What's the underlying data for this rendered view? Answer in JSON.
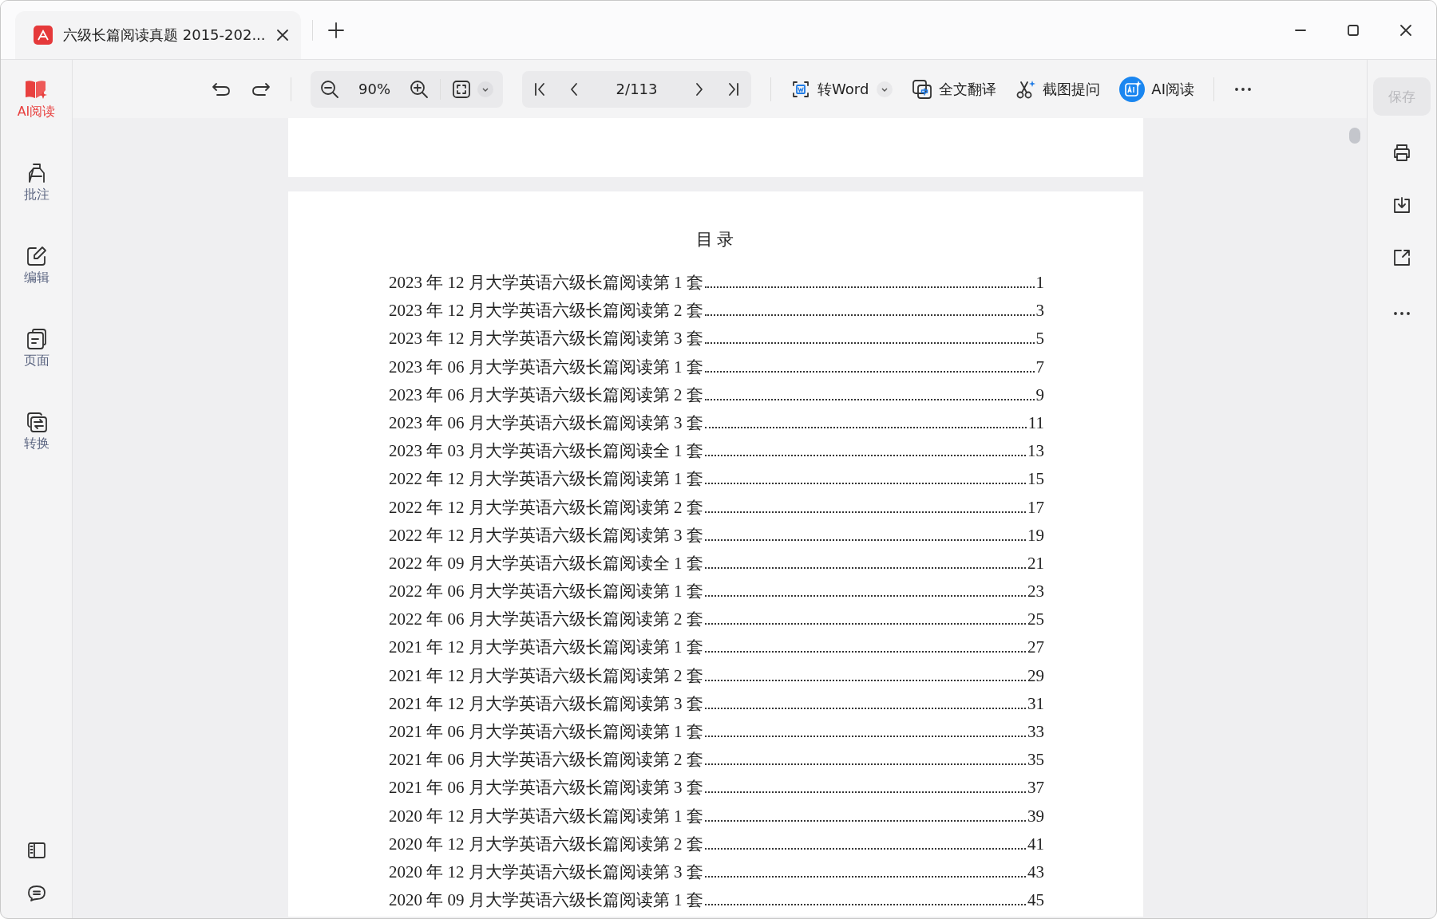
{
  "tab": {
    "title": "六级长篇阅读真题 2015-202..."
  },
  "sidebar": {
    "items": [
      {
        "label": "AI阅读",
        "kind": "ai",
        "selected": true
      },
      {
        "label": "批注",
        "kind": "annotate",
        "selected": false
      },
      {
        "label": "编辑",
        "kind": "edit",
        "selected": false
      },
      {
        "label": "页面",
        "kind": "pages",
        "selected": false
      },
      {
        "label": "转换",
        "kind": "convert",
        "selected": false
      }
    ]
  },
  "toolbar": {
    "zoom": "90%",
    "page": "2/113",
    "tools": [
      {
        "label": "转Word",
        "kind": "word"
      },
      {
        "label": "全文翻译",
        "kind": "translate"
      },
      {
        "label": "截图提问",
        "kind": "snip"
      },
      {
        "label": "AI阅读",
        "kind": "ai"
      }
    ]
  },
  "save_button": {
    "label": "保存",
    "disabled": true
  },
  "document": {
    "heading": "目录",
    "entries": [
      {
        "title": "2023 年 12 月大学英语六级长篇阅读第 1 套",
        "page": "1"
      },
      {
        "title": "2023 年 12 月大学英语六级长篇阅读第 2 套",
        "page": "3"
      },
      {
        "title": "2023 年 12 月大学英语六级长篇阅读第 3 套",
        "page": "5"
      },
      {
        "title": "2023 年 06 月大学英语六级长篇阅读第 1 套",
        "page": "7"
      },
      {
        "title": "2023 年 06 月大学英语六级长篇阅读第 2 套",
        "page": "9"
      },
      {
        "title": "2023 年 06 月大学英语六级长篇阅读第 3 套",
        "page": "11"
      },
      {
        "title": "2023 年 03 月大学英语六级长篇阅读全 1 套",
        "page": "13"
      },
      {
        "title": "2022 年 12 月大学英语六级长篇阅读第 1 套",
        "page": "15"
      },
      {
        "title": "2022 年 12 月大学英语六级长篇阅读第 2 套",
        "page": "17"
      },
      {
        "title": "2022 年 12 月大学英语六级长篇阅读第 3 套",
        "page": "19"
      },
      {
        "title": "2022 年 09 月大学英语六级长篇阅读全 1 套",
        "page": "21"
      },
      {
        "title": "2022 年 06 月大学英语六级长篇阅读第 1 套",
        "page": "23"
      },
      {
        "title": "2022 年 06 月大学英语六级长篇阅读第 2 套",
        "page": "25"
      },
      {
        "title": "2021 年 12 月大学英语六级长篇阅读第 1 套",
        "page": "27"
      },
      {
        "title": "2021 年 12 月大学英语六级长篇阅读第 2 套",
        "page": "29"
      },
      {
        "title": "2021 年 12 月大学英语六级长篇阅读第 3 套",
        "page": "31"
      },
      {
        "title": "2021 年 06 月大学英语六级长篇阅读第 1 套",
        "page": "33"
      },
      {
        "title": "2021 年 06 月大学英语六级长篇阅读第 2 套",
        "page": "35"
      },
      {
        "title": "2021 年 06 月大学英语六级长篇阅读第 3 套",
        "page": "37"
      },
      {
        "title": "2020 年 12 月大学英语六级长篇阅读第 1 套",
        "page": "39"
      },
      {
        "title": "2020 年 12 月大学英语六级长篇阅读第 2 套",
        "page": "41"
      },
      {
        "title": "2020 年 12 月大学英语六级长篇阅读第 3 套",
        "page": "43"
      },
      {
        "title": "2020 年 09 月大学英语六级长篇阅读第 1 套",
        "page": "45"
      }
    ]
  }
}
